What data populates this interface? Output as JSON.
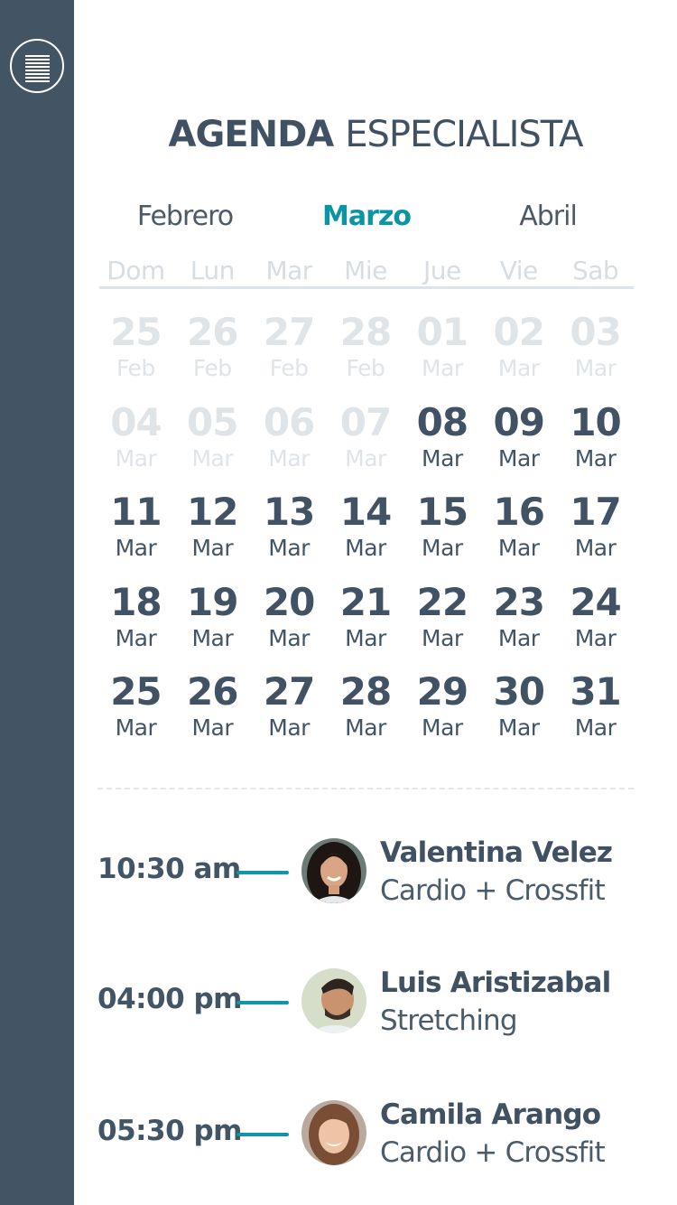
{
  "header": {
    "title_bold": "AGENDA",
    "title_light": "ESPECIALISTA",
    "menu_icon": "hamburger-menu-icon"
  },
  "months": [
    {
      "label": "Febrero",
      "active": false
    },
    {
      "label": "Marzo",
      "active": true
    },
    {
      "label": "Abril",
      "active": false
    }
  ],
  "weekdays": [
    "Dom",
    "Lun",
    "Mar",
    "Mie",
    "Jue",
    "Vie",
    "Sab"
  ],
  "days": [
    {
      "num": "25",
      "mon": "Feb",
      "faded": true
    },
    {
      "num": "26",
      "mon": "Feb",
      "faded": true
    },
    {
      "num": "27",
      "mon": "Feb",
      "faded": true
    },
    {
      "num": "28",
      "mon": "Feb",
      "faded": true
    },
    {
      "num": "01",
      "mon": "Mar",
      "faded": true
    },
    {
      "num": "02",
      "mon": "Mar",
      "faded": true
    },
    {
      "num": "03",
      "mon": "Mar",
      "faded": true
    },
    {
      "num": "04",
      "mon": "Mar",
      "faded": true
    },
    {
      "num": "05",
      "mon": "Mar",
      "faded": true
    },
    {
      "num": "06",
      "mon": "Mar",
      "faded": true
    },
    {
      "num": "07",
      "mon": "Mar",
      "faded": true
    },
    {
      "num": "08",
      "mon": "Mar",
      "faded": false
    },
    {
      "num": "09",
      "mon": "Mar",
      "faded": false
    },
    {
      "num": "10",
      "mon": "Mar",
      "faded": false
    },
    {
      "num": "11",
      "mon": "Mar",
      "faded": false
    },
    {
      "num": "12",
      "mon": "Mar",
      "faded": false
    },
    {
      "num": "13",
      "mon": "Mar",
      "faded": false
    },
    {
      "num": "14",
      "mon": "Mar",
      "faded": false
    },
    {
      "num": "15",
      "mon": "Mar",
      "faded": false
    },
    {
      "num": "16",
      "mon": "Mar",
      "faded": false
    },
    {
      "num": "17",
      "mon": "Mar",
      "faded": false
    },
    {
      "num": "18",
      "mon": "Mar",
      "faded": false
    },
    {
      "num": "19",
      "mon": "Mar",
      "faded": false
    },
    {
      "num": "20",
      "mon": "Mar",
      "faded": false
    },
    {
      "num": "21",
      "mon": "Mar",
      "faded": false
    },
    {
      "num": "22",
      "mon": "Mar",
      "faded": false
    },
    {
      "num": "23",
      "mon": "Mar",
      "faded": false
    },
    {
      "num": "24",
      "mon": "Mar",
      "faded": false
    },
    {
      "num": "25",
      "mon": "Mar",
      "faded": false
    },
    {
      "num": "26",
      "mon": "Mar",
      "faded": false
    },
    {
      "num": "27",
      "mon": "Mar",
      "faded": false
    },
    {
      "num": "28",
      "mon": "Mar",
      "faded": false
    },
    {
      "num": "29",
      "mon": "Mar",
      "faded": false
    },
    {
      "num": "30",
      "mon": "Mar",
      "faded": false
    },
    {
      "num": "31",
      "mon": "Mar",
      "faded": false
    }
  ],
  "appointments": [
    {
      "time": "10:30 am",
      "name": "Valentina Velez",
      "class": "Cardio + Crossfit",
      "avatar": "woman-portrait-avatar"
    },
    {
      "time": "04:00 pm",
      "name": "Luis Aristizabal",
      "class": "Stretching",
      "avatar": "man-portrait-avatar"
    },
    {
      "time": "05:30 pm",
      "name": "Camila Arango",
      "class": "Cardio + Crossfit",
      "avatar": "woman-portrait-avatar"
    }
  ],
  "colors": {
    "sidebar": "#435465",
    "accent": "#0a95a6",
    "text": "#425566",
    "faded": "#dfe4e8"
  }
}
